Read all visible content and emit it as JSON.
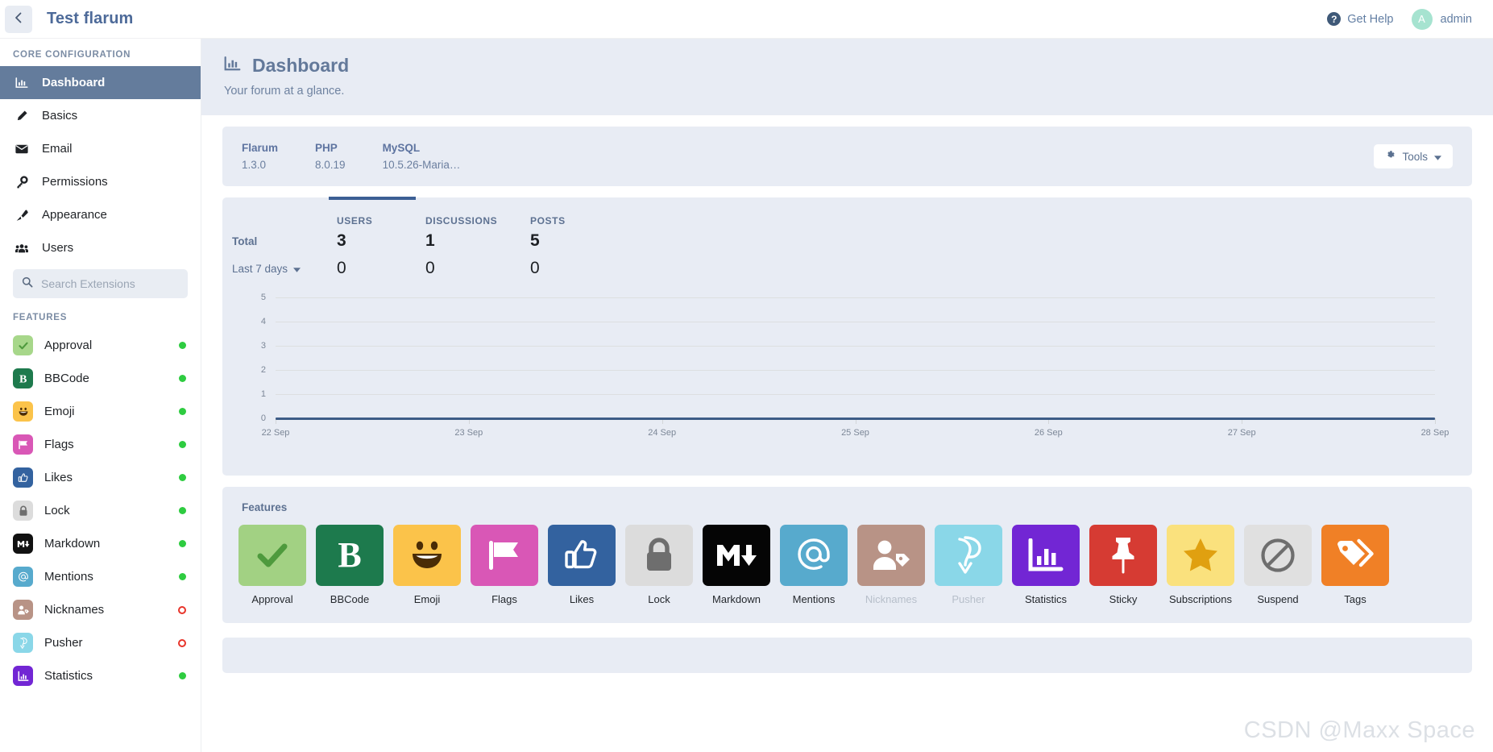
{
  "topbar": {
    "back_icon": "chevron-left-icon",
    "app_title": "Test flarum",
    "help_label": "Get Help",
    "help_icon": "question-circle-icon",
    "user_name": "admin",
    "avatar_initial": "A"
  },
  "sidebar": {
    "core_heading": "CORE CONFIGURATION",
    "core_items": [
      {
        "label": "Dashboard",
        "icon": "chart-bar-icon",
        "active": true
      },
      {
        "label": "Basics",
        "icon": "pencil-icon",
        "active": false
      },
      {
        "label": "Email",
        "icon": "envelope-icon",
        "active": false
      },
      {
        "label": "Permissions",
        "icon": "key-icon",
        "active": false
      },
      {
        "label": "Appearance",
        "icon": "paintbrush-icon",
        "active": false
      },
      {
        "label": "Users",
        "icon": "users-icon",
        "active": false
      }
    ],
    "search": {
      "placeholder": "Search Extensions",
      "value": "",
      "icon": "search-icon"
    },
    "features_heading": "FEATURES",
    "feature_items": [
      {
        "label": "Approval",
        "icon": "check-icon",
        "bg": "#a7d78a",
        "fg": "#3f8b34",
        "glyph": "check",
        "enabled": true
      },
      {
        "label": "BBCode",
        "icon": "bold-b-icon",
        "bg": "#1e7a4d",
        "fg": "#ffffff",
        "glyph": "B",
        "enabled": true
      },
      {
        "label": "Emoji",
        "icon": "smiley-icon",
        "bg": "#fbc34a",
        "fg": "#6b4509",
        "glyph": "smile",
        "enabled": true
      },
      {
        "label": "Flags",
        "icon": "flag-icon",
        "bg": "#d957b6",
        "fg": "#ffffff",
        "glyph": "flag",
        "enabled": true
      },
      {
        "label": "Likes",
        "icon": "thumbs-up-icon",
        "bg": "#33629f",
        "fg": "#ffffff",
        "glyph": "thumb",
        "enabled": true
      },
      {
        "label": "Lock",
        "icon": "lock-icon",
        "bg": "#dcdcdc",
        "fg": "#6e6e6e",
        "glyph": "lock",
        "enabled": true
      },
      {
        "label": "Markdown",
        "icon": "markdown-icon",
        "bg": "#111111",
        "fg": "#ffffff",
        "glyph": "md",
        "enabled": true
      },
      {
        "label": "Mentions",
        "icon": "at-sign-icon",
        "bg": "#57aacd",
        "fg": "#ffffff",
        "glyph": "at",
        "enabled": true
      },
      {
        "label": "Nicknames",
        "icon": "user-tag-icon",
        "bg": "#b89386",
        "fg": "#ffffff",
        "glyph": "usertag",
        "enabled": false
      },
      {
        "label": "Pusher",
        "icon": "pusher-icon",
        "bg": "#8ad7e8",
        "fg": "#ffffff",
        "glyph": "pusher",
        "enabled": false
      },
      {
        "label": "Statistics",
        "icon": "chart-bar-icon",
        "bg": "#7226d4",
        "fg": "#ffffff",
        "glyph": "chart",
        "enabled": true
      }
    ]
  },
  "page": {
    "title": "Dashboard",
    "title_icon": "chart-bar-icon",
    "subtitle": "Your forum at a glance."
  },
  "info": {
    "columns": [
      {
        "key": "Flarum",
        "value": "1.3.0"
      },
      {
        "key": "PHP",
        "value": "8.0.19"
      },
      {
        "key": "MySQL",
        "value": "10.5.26-Maria…"
      }
    ],
    "tools_label": "Tools",
    "tools_icon": "gear-icon",
    "tools_caret": "chevron-down-icon"
  },
  "stats": {
    "columns": [
      "USERS",
      "DISCUSSIONS",
      "POSTS"
    ],
    "active_column": "USERS",
    "rows": [
      {
        "label": "Total",
        "values": [
          "3",
          "1",
          "5"
        ]
      },
      {
        "label": "Last 7 days",
        "values": [
          "0",
          "0",
          "0"
        ],
        "has_dropdown": true,
        "caret": "chevron-down-icon"
      }
    ]
  },
  "chart_data": {
    "type": "line",
    "title": "",
    "xlabel": "",
    "ylabel": "",
    "categories": [
      "22 Sep",
      "23 Sep",
      "24 Sep",
      "25 Sep",
      "26 Sep",
      "27 Sep",
      "28 Sep"
    ],
    "series": [
      {
        "name": "Users",
        "values": [
          0,
          0,
          0,
          0,
          0,
          0,
          0
        ],
        "color": "#3d5c86"
      }
    ],
    "ylim": [
      0,
      5
    ],
    "yticks": [
      "5",
      "4",
      "3",
      "2",
      "1",
      "0"
    ],
    "grid": true,
    "legend": false
  },
  "features_panel": {
    "title": "Features",
    "items": [
      {
        "label": "Approval",
        "icon": "check-icon",
        "bg": "#a2d183",
        "glyph": "check",
        "enabled": true
      },
      {
        "label": "BBCode",
        "icon": "bold-b-icon",
        "bg": "#1d7a4d",
        "glyph": "B",
        "enabled": true
      },
      {
        "label": "Emoji",
        "icon": "smiley-icon",
        "bg": "#fbc34a",
        "glyph": "smile",
        "enabled": true
      },
      {
        "label": "Flags",
        "icon": "flag-icon",
        "bg": "#d957b6",
        "glyph": "flag",
        "enabled": true
      },
      {
        "label": "Likes",
        "icon": "thumbs-up-icon",
        "bg": "#33629f",
        "glyph": "thumb",
        "enabled": true
      },
      {
        "label": "Lock",
        "icon": "lock-icon",
        "bg": "#dcdcdc",
        "glyph": "lock",
        "enabled": true
      },
      {
        "label": "Markdown",
        "icon": "markdown-icon",
        "bg": "#050505",
        "glyph": "md",
        "enabled": true
      },
      {
        "label": "Mentions",
        "icon": "at-sign-icon",
        "bg": "#57aacd",
        "glyph": "at",
        "enabled": true
      },
      {
        "label": "Nicknames",
        "icon": "user-tag-icon",
        "bg": "#b89386",
        "glyph": "usertag",
        "enabled": false
      },
      {
        "label": "Pusher",
        "icon": "pusher-icon",
        "bg": "#8ad7e8",
        "glyph": "pusher",
        "enabled": false
      },
      {
        "label": "Statistics",
        "icon": "chart-bar-icon",
        "bg": "#7226d4",
        "glyph": "chart",
        "enabled": true
      },
      {
        "label": "Sticky",
        "icon": "thumbtack-icon",
        "bg": "#d63b33",
        "glyph": "pin",
        "enabled": true
      },
      {
        "label": "Subscriptions",
        "icon": "star-icon",
        "bg": "#fae17d",
        "glyph": "star",
        "enabled": true
      },
      {
        "label": "Suspend",
        "icon": "ban-icon",
        "bg": "#e0e0e0",
        "glyph": "ban",
        "enabled": true
      },
      {
        "label": "Tags",
        "icon": "tags-icon",
        "bg": "#f08026",
        "glyph": "tags",
        "enabled": true
      }
    ]
  },
  "watermark": {
    "text": "CSDN @Maxx Space"
  }
}
